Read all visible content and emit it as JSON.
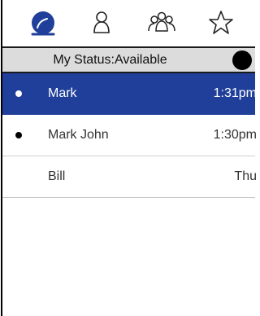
{
  "tabs": [
    {
      "icon": "recents-icon",
      "active": true
    },
    {
      "icon": "contact-icon",
      "active": false
    },
    {
      "icon": "groups-icon",
      "active": false
    },
    {
      "icon": "favorites-icon",
      "active": false
    }
  ],
  "status": {
    "label": "My Status:Available",
    "indicator_color": "#000000"
  },
  "conversations": [
    {
      "name": "Mark",
      "time": "1:31pm",
      "selected": true,
      "unread": true
    },
    {
      "name": "Mark John",
      "time": "1:30pm",
      "selected": false,
      "unread": true
    },
    {
      "name": "Bill",
      "time": "Thu",
      "selected": false,
      "unread": false
    }
  ],
  "colors": {
    "accent": "#1f3f9a",
    "status_bar": "#dcdcdc"
  }
}
